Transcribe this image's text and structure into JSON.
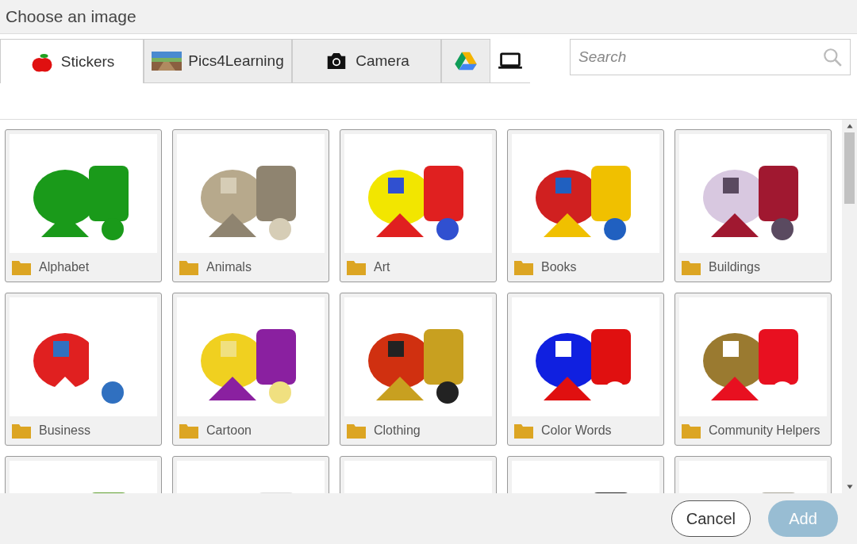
{
  "dialog": {
    "title": "Choose an image"
  },
  "tabs": [
    {
      "label": "Stickers",
      "selected": true
    },
    {
      "label": "Pics4Learning",
      "selected": false
    },
    {
      "label": "Camera",
      "selected": false
    },
    {
      "selected": false
    },
    {
      "selected": false
    }
  ],
  "search": {
    "placeholder": "Search"
  },
  "items": [
    {
      "kind": "folder",
      "label": "Alphabet"
    },
    {
      "kind": "folder",
      "label": "Animals"
    },
    {
      "kind": "folder",
      "label": "Art"
    },
    {
      "kind": "folder",
      "label": "Books"
    },
    {
      "kind": "folder",
      "label": "Buildings"
    },
    {
      "kind": "folder",
      "label": "Business"
    },
    {
      "kind": "folder",
      "label": "Cartoon"
    },
    {
      "kind": "folder",
      "label": "Clothing"
    },
    {
      "kind": "folder",
      "label": "Color Words"
    },
    {
      "kind": "folder",
      "label": "Community Helpers"
    },
    {
      "kind": "folder"
    },
    {
      "kind": "folder"
    },
    {
      "kind": "folder"
    },
    {
      "kind": "folder"
    },
    {
      "kind": "folder"
    }
  ],
  "buttons": [
    {
      "label": "Cancel",
      "disabled": false
    },
    {
      "label": "Add",
      "disabled": true
    }
  ]
}
